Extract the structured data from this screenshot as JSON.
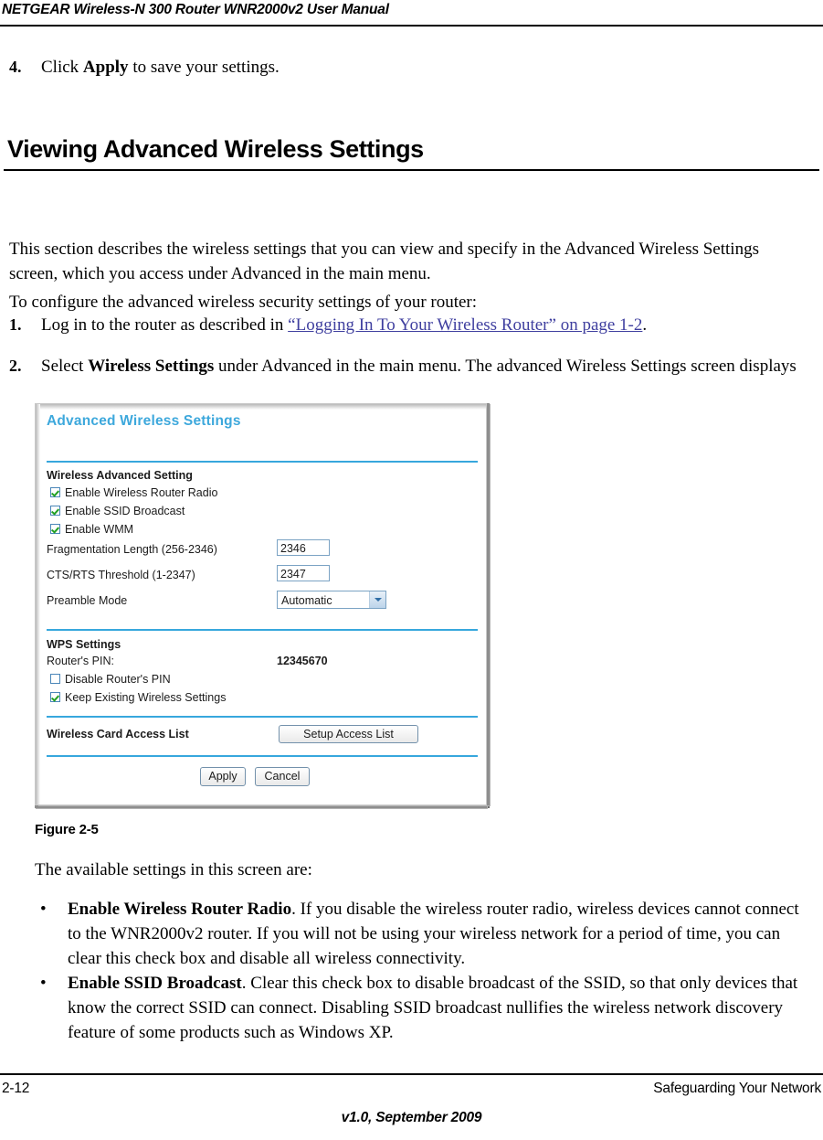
{
  "header": {
    "title": "NETGEAR Wireless-N 300 Router WNR2000v2 User Manual"
  },
  "body": {
    "step4_num": "4.",
    "step4_text_pre": "Click ",
    "step4_text_bold": "Apply",
    "step4_text_post": " to save your settings.",
    "section_heading": "Viewing Advanced Wireless Settings",
    "intro_paragraph": "This section describes the wireless settings that you can view and specify in the Advanced Wireless Settings screen, which you access under Advanced in the main menu.",
    "configure_paragraph": "To configure the advanced wireless security settings of your router:",
    "step1_num": "1.",
    "step1_pre": "Log in to the router as described in ",
    "step1_link": "“Logging In To Your Wireless Router” on page 1-2",
    "step1_post": ".",
    "step2_num": "2.",
    "step2_pre": "Select ",
    "step2_bold": "Wireless Settings",
    "step2_post": " under Advanced in the main menu. The advanced Wireless Settings screen displays",
    "figure_caption": "Figure 2-5",
    "available_settings_lead": "The available settings in this screen are:",
    "bullets": [
      {
        "marker": "•",
        "term": "Enable Wireless Router Radio",
        "text": ". If you disable the wireless router radio, wireless devices cannot connect to the WNR2000v2 router. If you will not be using your wireless network for a period of time, you can clear this check box and disable all wireless connectivity."
      },
      {
        "marker": "•",
        "term": "Enable SSID Broadcast",
        "text": ". Clear this check box to disable broadcast of the SSID, so that only devices that know the correct SSID can connect. Disabling SSID broadcast nullifies the wireless network discovery feature of some products such as Windows XP."
      }
    ]
  },
  "figure": {
    "title": "Advanced Wireless Settings",
    "title_color": "#3da8dc",
    "rule_color": "#37a7dd",
    "group_wireless_advanced": "Wireless Advanced Setting",
    "checkboxes": [
      {
        "label": "Enable Wireless Router Radio",
        "checked": true
      },
      {
        "label": "Enable SSID Broadcast",
        "checked": true
      },
      {
        "label": "Enable WMM",
        "checked": true
      }
    ],
    "fields": [
      {
        "label": "Fragmentation Length (256-2346)",
        "value": "2346"
      },
      {
        "label": "CTS/RTS Threshold (1-2347)",
        "value": "2347"
      }
    ],
    "preamble_label": "Preamble Mode",
    "preamble_value": "Automatic",
    "group_wps": "WPS Settings",
    "router_pin_label": "Router's PIN:",
    "router_pin_value": "12345670",
    "wps_checkboxes": [
      {
        "label": "Disable Router's PIN",
        "checked": false
      },
      {
        "label": "Keep Existing Wireless Settings",
        "checked": true
      }
    ],
    "group_wcal": "Wireless Card Access List",
    "setup_access_list_button": "Setup Access List",
    "apply_button": "Apply",
    "cancel_button": "Cancel"
  },
  "footer": {
    "page_number": "2-12",
    "section_name": "Safeguarding Your Network",
    "version": "v1.0, September 2009"
  }
}
